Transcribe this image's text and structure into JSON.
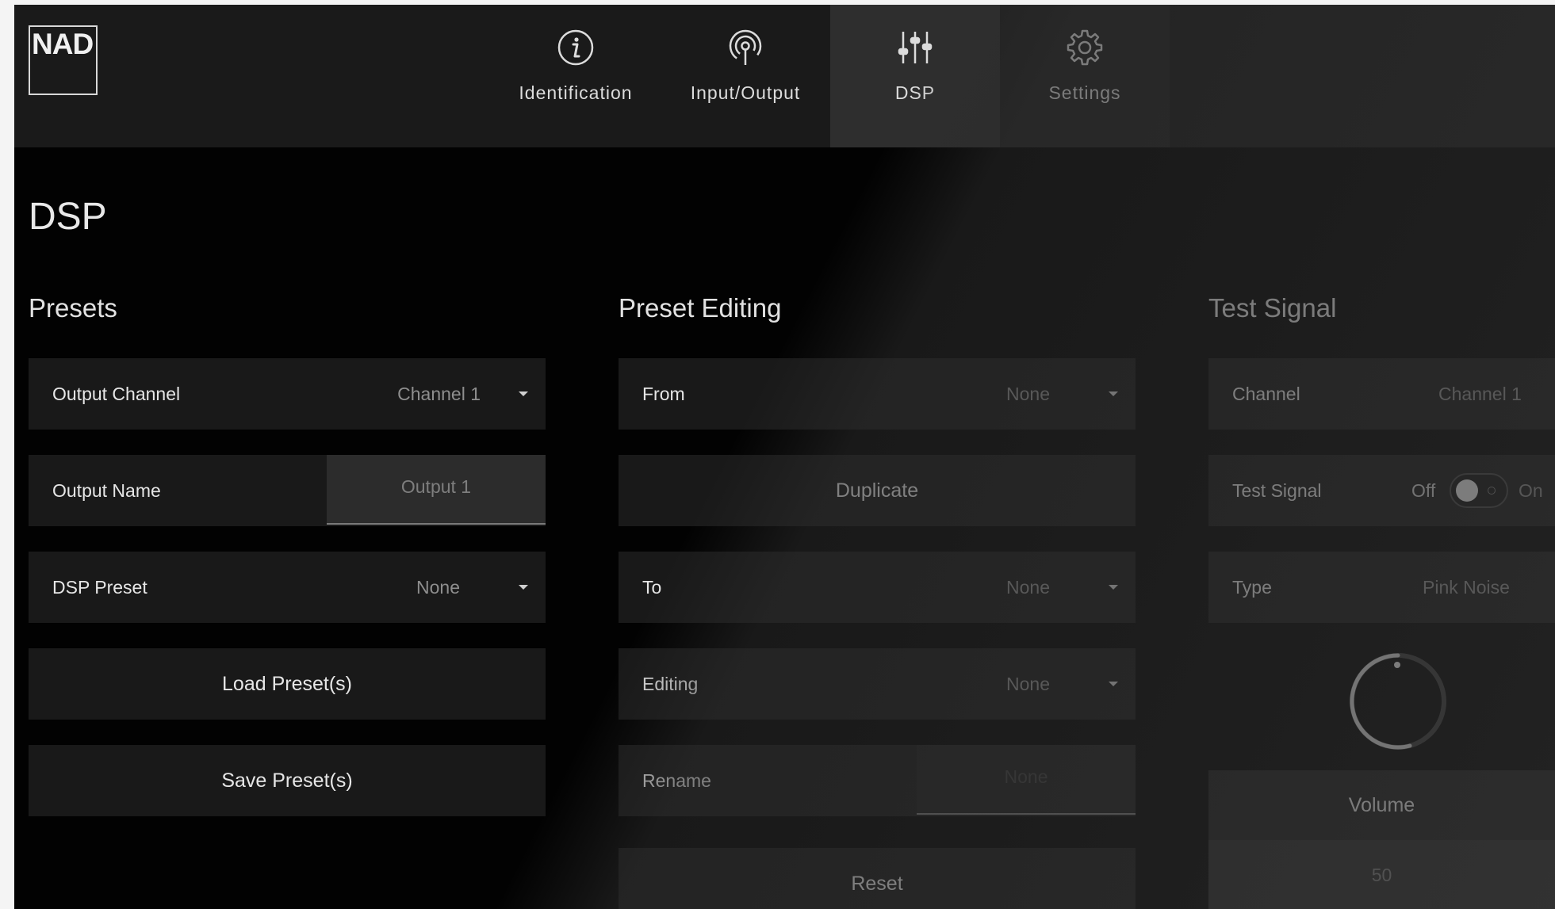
{
  "app": {
    "logo": "NAD"
  },
  "nav": {
    "tabs": [
      {
        "label": "Identification",
        "icon": "info-icon"
      },
      {
        "label": "Input/Output",
        "icon": "broadcast-icon"
      },
      {
        "label": "DSP",
        "icon": "sliders-icon",
        "active": true
      },
      {
        "label": "Settings",
        "icon": "gear-icon"
      }
    ]
  },
  "page": {
    "title": "DSP"
  },
  "presets": {
    "title": "Presets",
    "output_channel": {
      "label": "Output Channel",
      "value": "Channel 1"
    },
    "output_name": {
      "label": "Output Name",
      "placeholder": "Output 1"
    },
    "dsp_preset": {
      "label": "DSP Preset",
      "value": "None"
    },
    "load_label": "Load Preset(s)",
    "save_label": "Save Preset(s)"
  },
  "preset_editing": {
    "title": "Preset Editing",
    "from": {
      "label": "From",
      "value": "None"
    },
    "duplicate_label": "Duplicate",
    "to": {
      "label": "To",
      "value": "None"
    },
    "editing": {
      "label": "Editing",
      "value": "None"
    },
    "rename": {
      "label": "Rename",
      "placeholder": "None"
    },
    "reset_label": "Reset"
  },
  "test_signal": {
    "title": "Test Signal",
    "channel": {
      "label": "Channel",
      "value": "Channel 1"
    },
    "toggle": {
      "label": "Test Signal",
      "off": "Off",
      "on": "On",
      "state": "off"
    },
    "type": {
      "label": "Type",
      "value": "Pink Noise"
    },
    "volume": {
      "label": "Volume",
      "value": "50"
    }
  },
  "colors": {
    "background": "#020202",
    "panel": "#191919",
    "accent": "#e6e6e6"
  }
}
